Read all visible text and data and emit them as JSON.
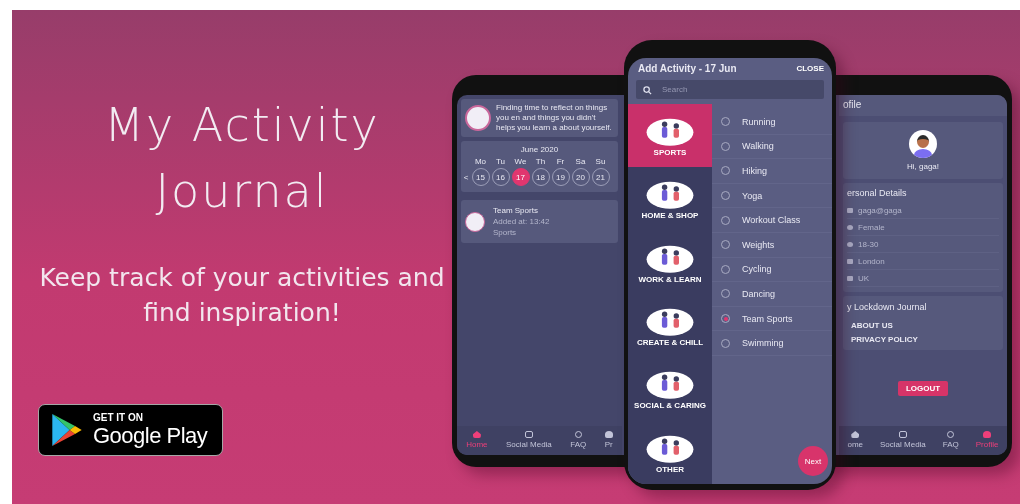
{
  "banner": {
    "title": "My Activity Journal",
    "tagline": "Keep track of your activities and find inspiration!"
  },
  "store_badge": {
    "caption": "GET IT ON",
    "store": "Google Play"
  },
  "journal_screen": {
    "reflection": "Finding time to reflect on things you en and things you didn't helps you learn a about yourself.",
    "month": "June 2020",
    "prev": "<",
    "weekdays": [
      "Mo",
      "Tu",
      "We",
      "Th",
      "Fr",
      "Sa",
      "Su"
    ],
    "days": [
      {
        "label": "15",
        "selected": false
      },
      {
        "label": "16",
        "selected": false
      },
      {
        "label": "17",
        "selected": true
      },
      {
        "label": "18",
        "selected": false
      },
      {
        "label": "19",
        "selected": false
      },
      {
        "label": "20",
        "selected": false
      },
      {
        "label": "21",
        "selected": false
      }
    ],
    "entry": {
      "title": "Team Sports",
      "time": "Added at: 13:42",
      "category": "Sports"
    },
    "nav": [
      {
        "label": "Home",
        "kind": "home",
        "selected": true
      },
      {
        "label": "Social Media",
        "kind": "media",
        "selected": false
      },
      {
        "label": "FAQ",
        "kind": "faq",
        "selected": false
      },
      {
        "label": "Pr",
        "kind": "profile",
        "selected": false
      }
    ]
  },
  "add_activity_screen": {
    "title": "Add Activity - 17 Jun",
    "close": "CLOSE",
    "search": {
      "placeholder": "Search"
    },
    "categories": [
      {
        "label": "SPORTS",
        "selected": true
      },
      {
        "label": "HOME & SHOP",
        "selected": false
      },
      {
        "label": "WORK & LEARN",
        "selected": false
      },
      {
        "label": "CREATE & CHILL",
        "selected": false
      },
      {
        "label": "SOCIAL & CARING",
        "selected": false
      },
      {
        "label": "OTHER",
        "selected": false
      }
    ],
    "activities": [
      {
        "label": "Running",
        "selected": false
      },
      {
        "label": "Walking",
        "selected": false
      },
      {
        "label": "Hiking",
        "selected": false
      },
      {
        "label": "Yoga",
        "selected": false
      },
      {
        "label": "Workout Class",
        "selected": false
      },
      {
        "label": "Weights",
        "selected": false
      },
      {
        "label": "Cycling",
        "selected": false
      },
      {
        "label": "Dancing",
        "selected": false
      },
      {
        "label": "Team Sports",
        "selected": true
      },
      {
        "label": "Swimming",
        "selected": false
      }
    ],
    "next": "Next"
  },
  "profile_screen": {
    "title": "ofile",
    "greeting": "Hi, gaga!",
    "details_heading": "ersonal Details",
    "details": [
      {
        "kind": "email",
        "value": "gaga@gaga"
      },
      {
        "kind": "gender",
        "value": "Female"
      },
      {
        "kind": "age",
        "value": "18-30"
      },
      {
        "kind": "city",
        "value": "London"
      },
      {
        "kind": "country",
        "value": "UK"
      }
    ],
    "about_heading": "y Lockdown Journal",
    "links": [
      "ABOUT US",
      "PRIVACY POLICY"
    ],
    "logout": "LOGOUT",
    "nav": [
      {
        "label": "ome",
        "kind": "home",
        "selected": false
      },
      {
        "label": "Social Media",
        "kind": "media",
        "selected": false
      },
      {
        "label": "FAQ",
        "kind": "faq",
        "selected": false
      },
      {
        "label": "Profile",
        "kind": "profile",
        "selected": true
      }
    ]
  }
}
